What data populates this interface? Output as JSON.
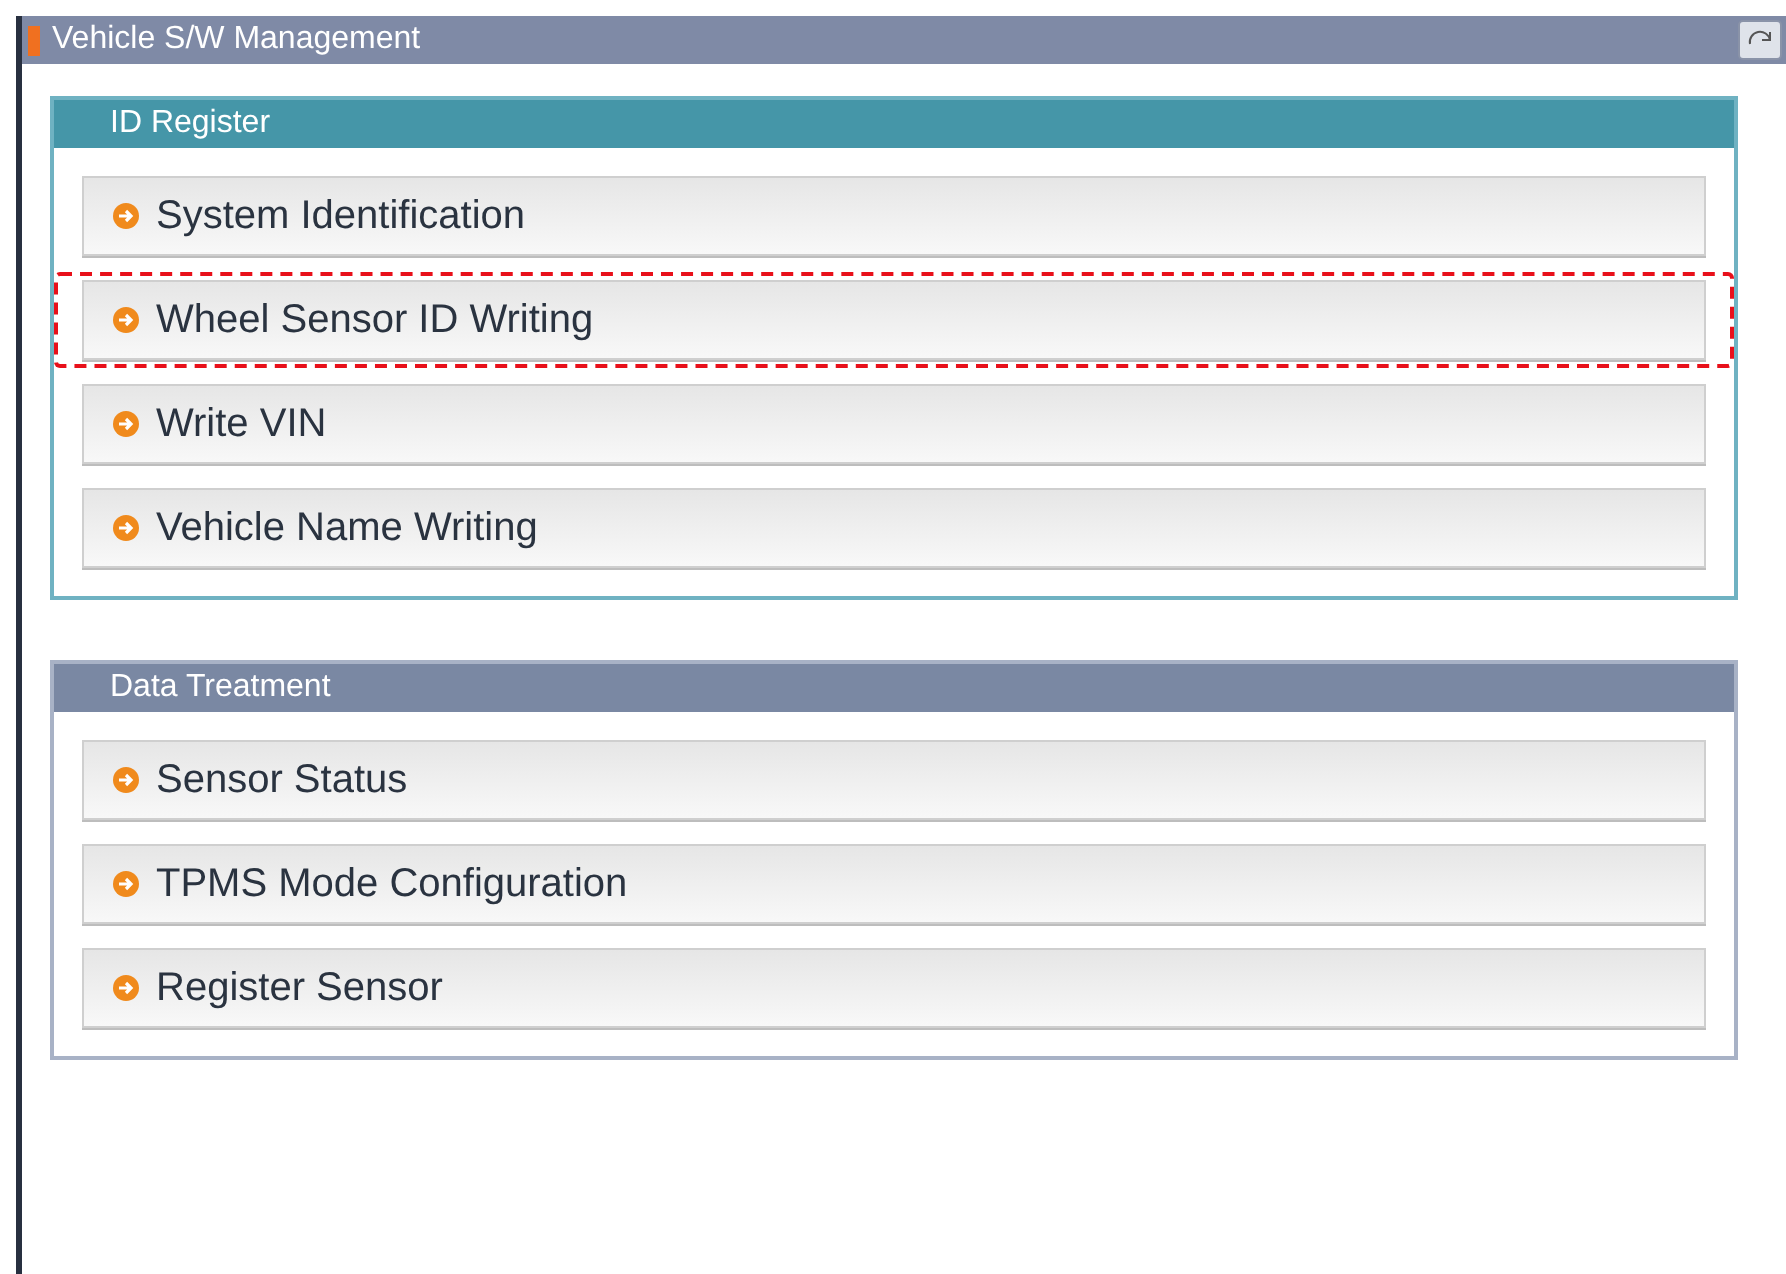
{
  "window": {
    "title": "Vehicle S/W Management"
  },
  "sections": [
    {
      "title": "ID Register",
      "active": true,
      "items": [
        {
          "label": "System Identification",
          "highlighted": false
        },
        {
          "label": "Wheel Sensor ID Writing",
          "highlighted": true
        },
        {
          "label": "Write VIN",
          "highlighted": false
        },
        {
          "label": "Vehicle Name Writing",
          "highlighted": false
        }
      ]
    },
    {
      "title": "Data Treatment",
      "active": false,
      "items": [
        {
          "label": "Sensor Status",
          "highlighted": false
        },
        {
          "label": "TPMS Mode Configuration",
          "highlighted": false
        },
        {
          "label": "Register Sensor",
          "highlighted": false
        }
      ]
    }
  ]
}
